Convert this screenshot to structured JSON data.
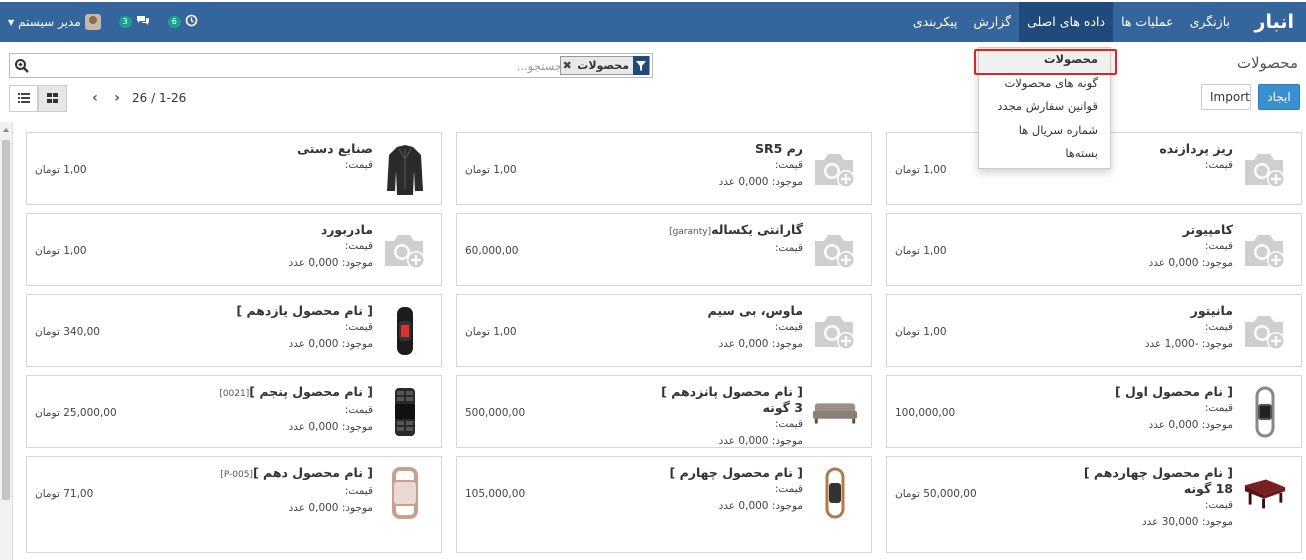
{
  "navbar": {
    "brand": "انبار",
    "menu": [
      "بازنگری",
      "عملیات ها",
      "داده های اصلی",
      "گزارش",
      "پیکربندی"
    ],
    "active_menu": "داده های اصلی",
    "activity_count": "6",
    "message_count": "3",
    "user_name": "مدیر سیستم"
  },
  "page": {
    "title": "محصولات",
    "create_label": "ایجاد",
    "import_label": "Import"
  },
  "search": {
    "placeholder": "جستجو...",
    "facet": "محصولات"
  },
  "pager": {
    "range": "1-26",
    "total": "26",
    "separator": "/"
  },
  "dropdown": {
    "items": [
      "محصولات",
      "گونه های محصولات",
      "قوانین سفارش مجدد",
      "شماره سریال ها",
      "بسته‌ها"
    ]
  },
  "icons": {
    "search_zoom": "search-plus-icon",
    "filter": "filter-icon",
    "kanban": "grid-icon",
    "list": "list-icon",
    "placeholder_image": "camera-plus-icon"
  },
  "colors": {
    "navbar": "#34659c",
    "navbar_active": "#1f4a7a",
    "primary": "#3a8fd0",
    "badge": "#18a193",
    "highlight": "#e32222"
  },
  "products": [
    {
      "name": "ریز پردازنده",
      "ref": "",
      "variants": "",
      "price_label": "قیمت:",
      "stock": "",
      "price": "1,00 تومان",
      "image": "placeholder"
    },
    {
      "name": "رم SR5",
      "ref": "",
      "variants": "",
      "price_label": "قیمت:",
      "stock": "موجود: 0,000 عدد",
      "price": "1,00 تومان",
      "image": "placeholder"
    },
    {
      "name": "صنایع دستی",
      "ref": "",
      "variants": "",
      "price_label": "قیمت:",
      "stock": "",
      "price": "1,00 تومان",
      "image": "jacket"
    },
    {
      "name": "کامپیوتر",
      "ref": "",
      "variants": "",
      "price_label": "قیمت:",
      "stock": "موجود: 0,000 عدد",
      "price": "1,00 تومان",
      "image": "placeholder"
    },
    {
      "name": "گارانتی یکساله",
      "ref": "[garanty]",
      "variants": "",
      "price_label": "قیمت:",
      "stock": "",
      "price": "60,000,00",
      "image": "placeholder"
    },
    {
      "name": "مادربورد",
      "ref": "",
      "variants": "",
      "price_label": "قیمت:",
      "stock": "موجود: 0,000 عدد",
      "price": "1,00 تومان",
      "image": "placeholder"
    },
    {
      "name": "مانیتور",
      "ref": "",
      "variants": "",
      "price_label": "قیمت:",
      "stock": "موجود: -1,000 عدد",
      "price": "1,00 تومان",
      "image": "placeholder"
    },
    {
      "name": "ماوس، بی سیم",
      "ref": "",
      "variants": "",
      "price_label": "قیمت:",
      "stock": "موجود: 0,000 عدد",
      "price": "1,00 تومان",
      "image": "placeholder"
    },
    {
      "name": "[ نام محصول یازدهم ]",
      "ref": "",
      "variants": "",
      "price_label": "قیمت:",
      "stock": "موجود: 0,000 عدد",
      "price": "340,00 تومان",
      "image": "band"
    },
    {
      "name": "[ نام محصول اول ]",
      "ref": "",
      "variants": "",
      "price_label": "قیمت:",
      "stock": "موجود: 0,000 عدد",
      "price": "100,000,00",
      "image": "watch-silver"
    },
    {
      "name": "[ نام محصول پانزدهم ]",
      "ref": "",
      "variants": "3 گونه",
      "price_label": "قیمت:",
      "stock": "موجود: 0,000 عدد",
      "price": "500,000,00",
      "image": "sofa"
    },
    {
      "name": "[ نام محصول پنجم ]",
      "ref": "[0021]",
      "variants": "",
      "price_label": "قیمت:",
      "stock": "موجود: 0,000 عدد",
      "price": "25,000,00 تومان",
      "image": "watch-black"
    },
    {
      "name": "[ نام محصول چهاردهم ]",
      "ref": "",
      "variants": "18 گونه",
      "price_label": "قیمت:",
      "stock": "موجود: 30,000 عدد",
      "price": "50,000,00 تومان",
      "image": "table"
    },
    {
      "name": "[ نام محصول چهارم ]",
      "ref": "",
      "variants": "",
      "price_label": "قیمت:",
      "stock": "موجود: 0,000 عدد",
      "price": "105,000,00",
      "image": "band-gold"
    },
    {
      "name": "[ نام محصول دهم ]",
      "ref": "[P-005]",
      "variants": "",
      "price_label": "قیمت:",
      "stock": "موجود: 0,000 عدد",
      "price": "71,00 تومان",
      "image": "watch-rose"
    }
  ]
}
